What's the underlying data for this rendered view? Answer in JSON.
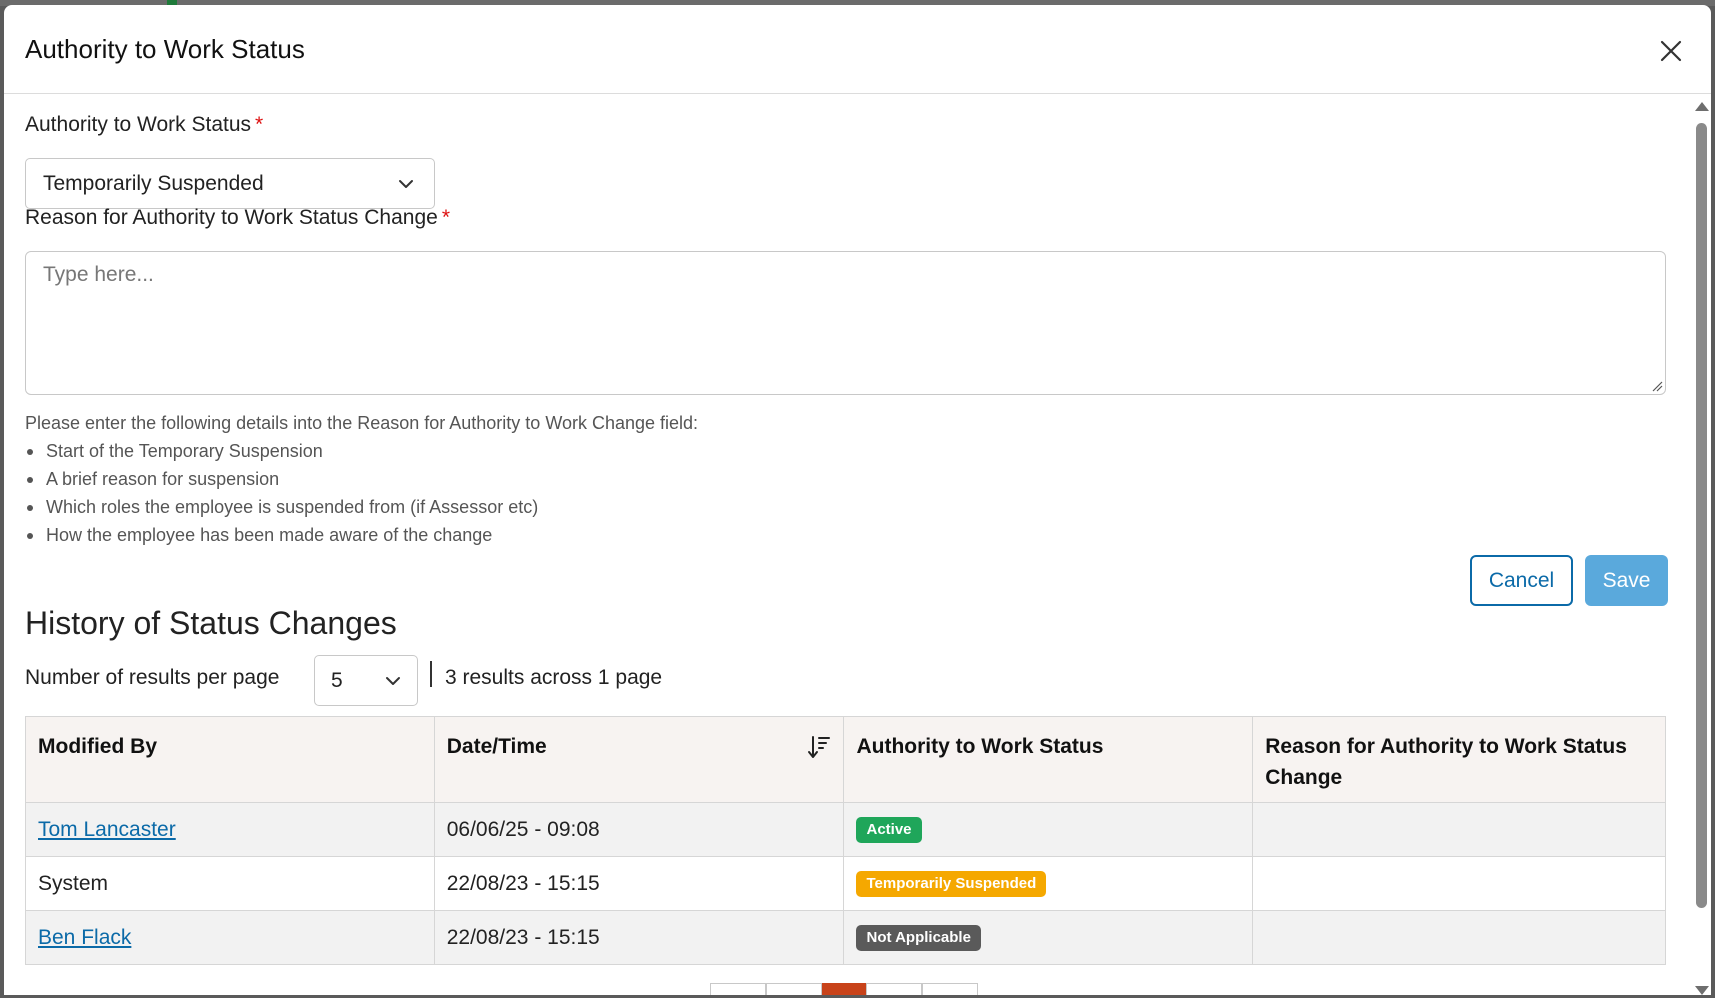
{
  "modal": {
    "title": "Authority to Work Status"
  },
  "form": {
    "status_label": "Authority to Work Status",
    "required_mark": "*",
    "status_value": "Temporarily Suspended",
    "reason_label": "Reason for Authority to Work Status Change",
    "reason_placeholder": "Type here...",
    "reason_value": "",
    "help_intro": "Please enter the following details into the Reason for Authority to Work Change field:",
    "help_items": [
      "Start of the Temporary Suspension",
      "A brief reason for suspension",
      "Which roles the employee is suspended from (if Assessor etc)",
      "How the employee has been made aware of the change"
    ],
    "cancel_label": "Cancel",
    "save_label": "Save"
  },
  "history": {
    "title": "History of Status Changes",
    "per_page_label": "Number of results per page",
    "per_page_value": "5",
    "results_text": "3 results across 1 page",
    "columns": [
      "Modified By",
      "Date/Time",
      "Authority to Work Status",
      "Reason for Authority to Work Status Change"
    ],
    "rows": [
      {
        "modified_by": "Tom Lancaster",
        "is_link": true,
        "datetime": "06/06/25 - 09:08",
        "status": "Active",
        "reason": ""
      },
      {
        "modified_by": "System",
        "is_link": false,
        "datetime": "22/08/23 - 15:15",
        "status": "Temporarily Suspended",
        "reason": ""
      },
      {
        "modified_by": "Ben Flack",
        "is_link": true,
        "datetime": "22/08/23 - 15:15",
        "status": "Not Applicable",
        "reason": ""
      }
    ]
  },
  "colors": {
    "accent": "#0b6aa8",
    "save_button": "#5aa9dc",
    "badge_active": "#1fa65a",
    "badge_suspended": "#f5a800",
    "badge_not_applicable": "#5a5a5a",
    "pager_active": "#c8431a",
    "required": "#dd1111"
  },
  "icons": {
    "close": "close-icon",
    "dropdown": "chevron-down-icon",
    "sort": "sort-descending-icon"
  }
}
